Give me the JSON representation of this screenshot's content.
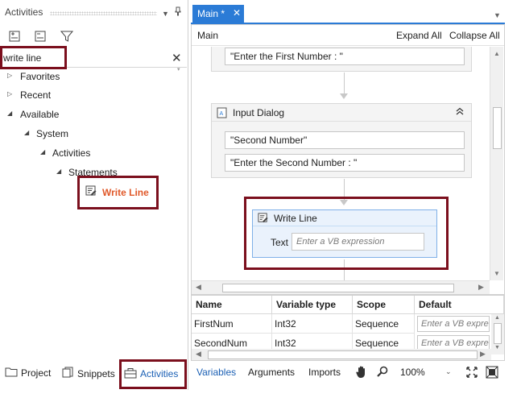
{
  "activities_panel": {
    "title": "Activities",
    "search": {
      "value": "write line",
      "clear_glyph": "✕"
    },
    "tree": {
      "favorites": "Favorites",
      "recent": "Recent",
      "available": "Available",
      "system": "System",
      "activities": "Activities",
      "statements": "Statements",
      "write_line": "Write Line"
    },
    "tabs": {
      "project": "Project",
      "snippets": "Snippets",
      "activities": "Activities"
    }
  },
  "document": {
    "tab_label": "Main *",
    "close_glyph": "✕",
    "breadcrumb": "Main",
    "expand_all": "Expand All",
    "collapse_all": "Collapse All"
  },
  "canvas": {
    "first_prompt": "\"Enter the First Number : \"",
    "input_dialog": {
      "title": "Input Dialog",
      "title_field": "\"Second Number\"",
      "label_field": "\"Enter the Second Number : \""
    },
    "write_line": {
      "title": "Write Line",
      "text_label": "Text",
      "text_placeholder": "Enter a VB expression"
    }
  },
  "variables": {
    "columns": [
      "Name",
      "Variable type",
      "Scope",
      "Default"
    ],
    "rows": [
      {
        "name": "FirstNum",
        "type": "Int32",
        "scope": "Sequence",
        "default_placeholder": "Enter a VB expre"
      },
      {
        "name": "SecondNum",
        "type": "Int32",
        "scope": "Sequence",
        "default_placeholder": "Enter a VB expre"
      }
    ]
  },
  "bottom_bar": {
    "variables": "Variables",
    "arguments": "Arguments",
    "imports": "Imports",
    "zoom": "100%"
  },
  "colors": {
    "accent": "#2b7bd6",
    "highlight": "#7b0f1d",
    "write_line_label": "#e0592a"
  }
}
